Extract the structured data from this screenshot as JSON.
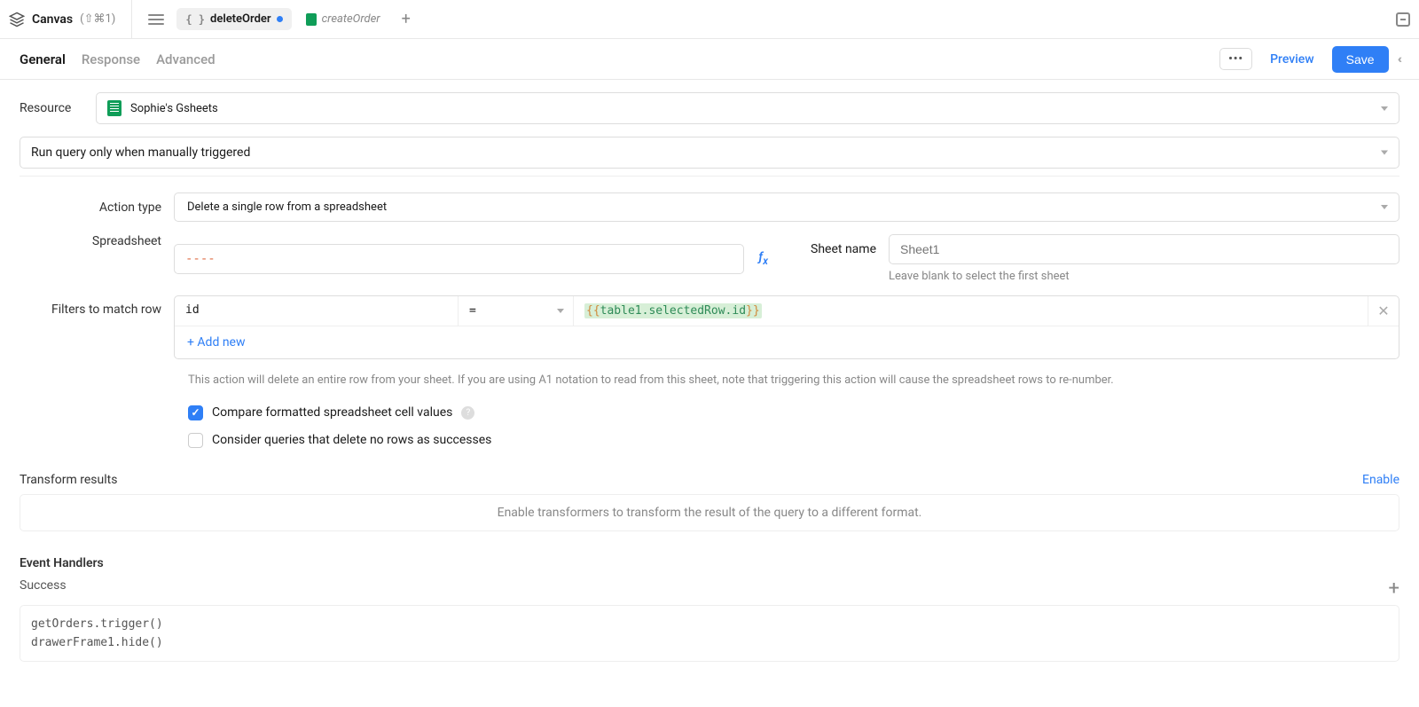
{
  "topbar": {
    "canvas_label": "Canvas",
    "canvas_shortcut": "(⇧⌘1)",
    "tabs": [
      {
        "label": "deleteOrder",
        "active": true,
        "dirty": true
      },
      {
        "label": "createOrder",
        "active": false,
        "dirty": false
      }
    ]
  },
  "subnav": {
    "tabs": [
      "General",
      "Response",
      "Advanced"
    ],
    "active": "General",
    "preview": "Preview",
    "save": "Save"
  },
  "resource": {
    "label": "Resource",
    "value": "Sophie's Gsheets"
  },
  "run_mode": {
    "value": "Run query only when manually triggered"
  },
  "action_type": {
    "label": "Action type",
    "value": "Delete a single row from a spreadsheet"
  },
  "spreadsheet": {
    "label": "Spreadsheet",
    "value": "----"
  },
  "sheet_name": {
    "label": "Sheet name",
    "placeholder": "Sheet1",
    "hint": "Leave blank to select the first sheet"
  },
  "filters": {
    "label": "Filters to match row",
    "key": "id",
    "op": "=",
    "val_template_open": "{{",
    "val_template_body": "table1.selectedRow.id",
    "val_template_close": "}}",
    "add_new": "+ Add new",
    "note": "This action will delete an entire row from your sheet. If you are using A1 notation to read from this sheet, note that triggering this action will cause the spreadsheet rows to re-number."
  },
  "checks": {
    "compare": "Compare formatted spreadsheet cell values",
    "consider": "Consider queries that delete no rows as successes"
  },
  "transform": {
    "title": "Transform results",
    "enable": "Enable",
    "hint": "Enable transformers to transform the result of the query to a different format."
  },
  "events": {
    "title": "Event Handlers",
    "success_label": "Success",
    "handlers": [
      "getOrders.trigger()",
      "drawerFrame1.hide()"
    ]
  }
}
